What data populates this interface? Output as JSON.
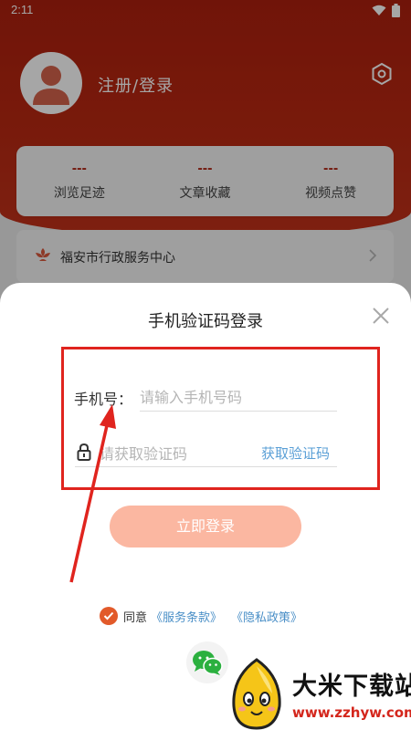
{
  "status_bar": {
    "time": "2:11"
  },
  "profile": {
    "login_label": "注册/登录"
  },
  "stats": [
    {
      "value": "---",
      "label": "浏览足迹"
    },
    {
      "value": "---",
      "label": "文章收藏"
    },
    {
      "value": "---",
      "label": "视频点赞"
    }
  ],
  "service": {
    "label": "福安市行政服务中心"
  },
  "login_sheet": {
    "title": "手机验证码登录",
    "phone_label": "手机号：",
    "phone_placeholder": "请输入手机号码",
    "code_placeholder": "请获取验证码",
    "get_code_label": "获取验证码",
    "login_button": "立即登录",
    "agree_text": "同意",
    "terms_link": "《服务条款》",
    "privacy_link": "《隐私政策》"
  },
  "watermark": {
    "title": "大米下载站",
    "url": "www.zzhyw.com"
  },
  "colors": {
    "brand_red": "#b02614",
    "annotation_red": "#e0241e",
    "link_blue": "#4a8fc7",
    "button_peach": "#fbb7a1"
  },
  "icons": [
    "wifi-icon",
    "battery-icon",
    "avatar-icon",
    "settings-icon",
    "flower-icon",
    "chevron-right-icon",
    "close-icon",
    "lock-icon",
    "check-icon",
    "wechat-icon"
  ]
}
